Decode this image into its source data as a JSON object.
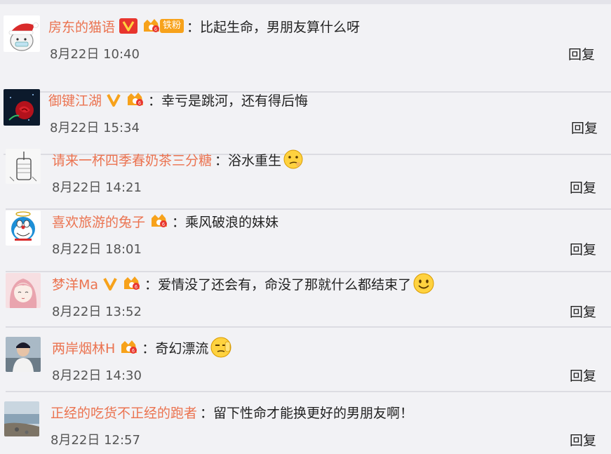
{
  "comments": [
    {
      "avatar": "santa-hat-cat-avatar",
      "username": "房东的猫语",
      "badges": [
        "v-verified-badge",
        "vip-crown-badge",
        "fan-tiefen-badge"
      ],
      "fan_badge_text": "铁粉",
      "text": "比起生命，男朋友算什么呀",
      "emoji": "",
      "time": "8月22日 10:40",
      "reply_label": "回复"
    },
    {
      "avatar": "red-rose-avatar",
      "username": "御键江湖",
      "badges": [
        "v-verified-badge",
        "vip-crown-badge"
      ],
      "text": "幸亏是跳河，还有得后悔",
      "emoji": "",
      "time": "8月22日 15:34",
      "reply_label": "回复"
    },
    {
      "avatar": "sketch-cup-avatar",
      "username": "请来一杯四季春奶茶三分糖",
      "badges": [],
      "text": "浴水重生",
      "emoji": "thinking-emoji",
      "time": "8月22日 14:21",
      "reply_label": "回复"
    },
    {
      "avatar": "doraemon-avatar",
      "username": "喜欢旅游的兔子",
      "badges": [
        "vip-crown-badge"
      ],
      "text": "乘风破浪的妹妹",
      "emoji": "",
      "time": "8月22日 18:01",
      "reply_label": "回复"
    },
    {
      "avatar": "anime-girl-avatar",
      "username": "梦洋Ma",
      "badges": [
        "v-verified-badge",
        "vip-crown-badge"
      ],
      "text": "爱情没了还会有，命没了那就什么都结束了",
      "emoji": "smile-emoji",
      "time": "8月22日 13:52",
      "reply_label": "回复"
    },
    {
      "avatar": "person-cap-avatar",
      "username": "两岸烟林H",
      "badges": [
        "vip-crown-badge"
      ],
      "text": "奇幻漂流",
      "emoji": "facepalm-emoji",
      "time": "8月22日 14:30",
      "reply_label": "回复"
    },
    {
      "avatar": "seaside-avatar",
      "username": "正经的吃货不正经的跑者",
      "badges": [],
      "text": "留下性命才能换更好的男朋友啊！",
      "emoji": "",
      "time": "8月22日 12:57",
      "reply_label": "回复"
    }
  ],
  "colon": "：",
  "colors": {
    "username": "#eb7350",
    "background": "#f2f2f5",
    "badge_orange": "#f7a21b",
    "separator": "#dcdce2"
  }
}
